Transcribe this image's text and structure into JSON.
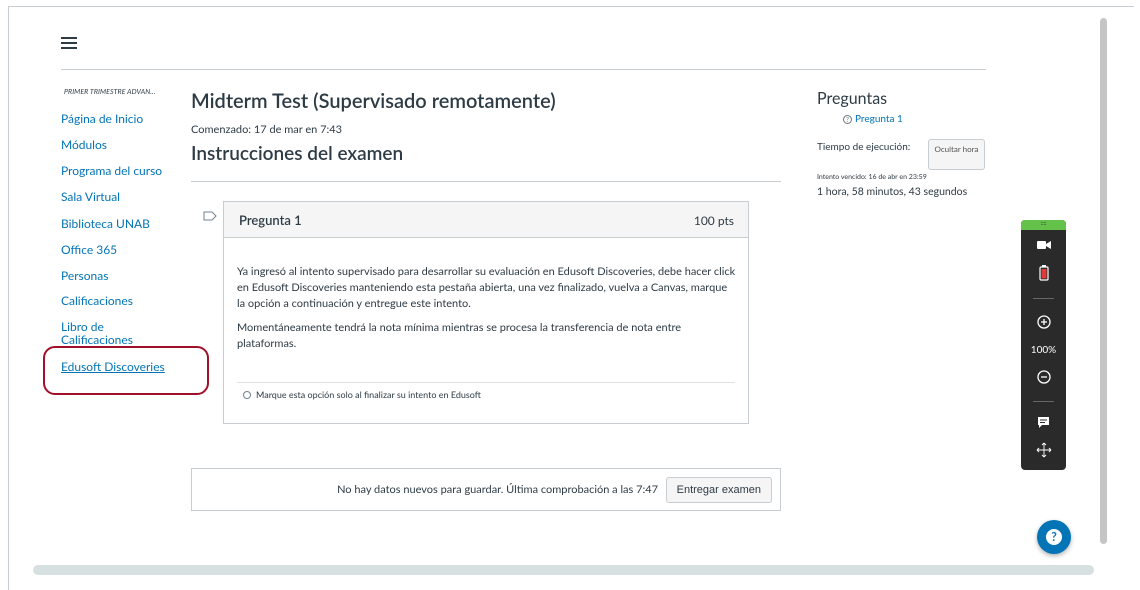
{
  "nav": {
    "course_crumb": "PRIMER TRIMESTRE ADVAN...",
    "items": [
      {
        "label": "Página de Inicio"
      },
      {
        "label": "Módulos"
      },
      {
        "label": "Programa del curso"
      },
      {
        "label": "Sala Virtual"
      },
      {
        "label": "Biblioteca UNAB"
      },
      {
        "label": "Office 365"
      },
      {
        "label": "Personas"
      },
      {
        "label": "Calificaciones"
      },
      {
        "label": "Libro de Calificaciones"
      },
      {
        "label": "Edusoft Discoveries"
      }
    ]
  },
  "quiz": {
    "title": "Midterm Test (Supervisado remotamente)",
    "started": "Comenzado: 17 de mar en 7:43",
    "instructions_heading": "Instrucciones del examen"
  },
  "question": {
    "name": "Pregunta 1",
    "points": "100 pts",
    "paragraph1": "Ya ingresó al intento supervisado para desarrollar su evaluación en Edusoft Discoveries, debe hacer click en Edusoft Discoveries manteniendo esta pestaña abierta, una vez finalizado, vuelva a Canvas, marque la opción a continuación y entregue este intento.",
    "paragraph2": "Momentáneamente tendrá la nota mínima mientras se procesa la transferencia de nota entre plataformas.",
    "option": "Marque esta opción solo al finalizar su intento en Edusoft"
  },
  "footer": {
    "save_message": "No hay datos nuevos para guardar. Última comprobación a las 7:47",
    "submit_label": "Entregar examen"
  },
  "sidebar": {
    "title": "Preguntas",
    "question_link": "Pregunta 1",
    "time_label": "Tiempo de ejecución:",
    "hide_button": "Ocultar hora",
    "overdue": "Intento vencido: 16 de abr en 23:59",
    "time_left": "1 hora, 58 minutos, 43 segundos"
  },
  "toolbar": {
    "grip": "::::",
    "zoom": "100%",
    "icons": [
      "camera-icon",
      "battery-icon",
      "zoom-in-icon",
      "zoom-out-icon",
      "chat-icon",
      "move-icon"
    ]
  },
  "help_button": "?",
  "colors": {
    "link": "#0374b5",
    "text": "#2d3b45",
    "highlight": "#a0102a",
    "toolbar_bg": "#2a2a2a",
    "toolbar_accent": "#64c24b"
  }
}
